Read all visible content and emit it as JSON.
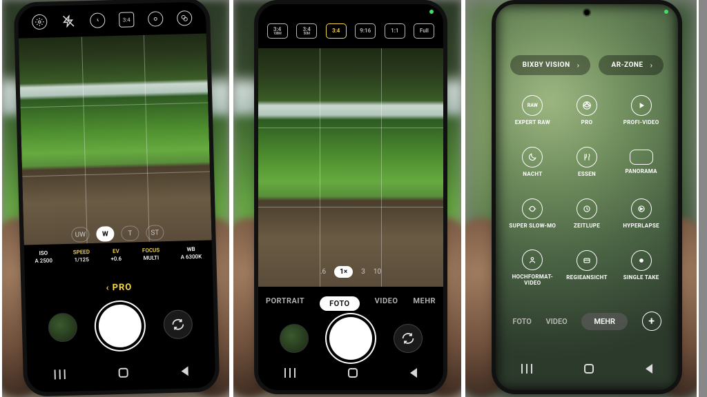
{
  "panel1": {
    "top_icons": [
      "settings",
      "flash-off",
      "timer",
      "ratio-3-4",
      "metering",
      "filter"
    ],
    "ratio_label": "3:4",
    "lenses": [
      {
        "label": "UW",
        "active": false
      },
      {
        "label": "W",
        "active": true
      },
      {
        "label": "T",
        "active": false
      },
      {
        "label": "ST",
        "active": false
      }
    ],
    "pro_params": [
      {
        "label": "ISO",
        "value": "A 2500",
        "white": true
      },
      {
        "label": "SPEED",
        "value": "1/125"
      },
      {
        "label": "EV",
        "value": "+0.6"
      },
      {
        "label": "FOCUS",
        "value": "MULTI"
      },
      {
        "label": "WB",
        "value": "A 6300K",
        "white": true
      }
    ],
    "mode": "PRO",
    "mode_prefix": "‹"
  },
  "panel2": {
    "aspects": [
      {
        "a": "3:4",
        "b": "108M"
      },
      {
        "a": "3:4",
        "b": "50M"
      },
      {
        "a": "3:4",
        "b": "",
        "active": true
      },
      {
        "a": "9:16",
        "b": ""
      },
      {
        "a": "1:1",
        "b": ""
      },
      {
        "a": "Full",
        "b": ""
      }
    ],
    "zoom": [
      {
        "label": ".6"
      },
      {
        "label": "1×",
        "active": true
      },
      {
        "label": "3"
      },
      {
        "label": "10"
      }
    ],
    "modes": [
      {
        "label": "PORTRAIT"
      },
      {
        "label": "FOTO",
        "active": true
      },
      {
        "label": "VIDEO"
      },
      {
        "label": "MEHR"
      }
    ]
  },
  "panel3": {
    "pills": [
      {
        "label": "BIXBY VISION"
      },
      {
        "label": "AR-ZONE"
      }
    ],
    "tiles": [
      {
        "icon": "raw",
        "label": "EXPERT RAW"
      },
      {
        "icon": "aperture",
        "label": "PRO"
      },
      {
        "icon": "play",
        "label": "PROFI-VIDEO"
      },
      {
        "icon": "moon",
        "label": "NACHT"
      },
      {
        "icon": "food",
        "label": "ESSEN"
      },
      {
        "icon": "pano",
        "label": "PANORAMA"
      },
      {
        "icon": "slowmo",
        "label": "SUPER SLOW-MO"
      },
      {
        "icon": "zeitlupe",
        "label": "ZEITLUPE"
      },
      {
        "icon": "hyper",
        "label": "HYPERLAPSE"
      },
      {
        "icon": "portraitvid",
        "label": "HOCHFORMAT-\nVIDEO"
      },
      {
        "icon": "director",
        "label": "REGIEANSICHT"
      },
      {
        "icon": "single",
        "label": "SINGLE TAKE"
      }
    ],
    "bottom_modes": [
      {
        "label": "FOTO"
      },
      {
        "label": "VIDEO"
      },
      {
        "label": "MEHR",
        "active": true
      }
    ],
    "plus": "+"
  }
}
